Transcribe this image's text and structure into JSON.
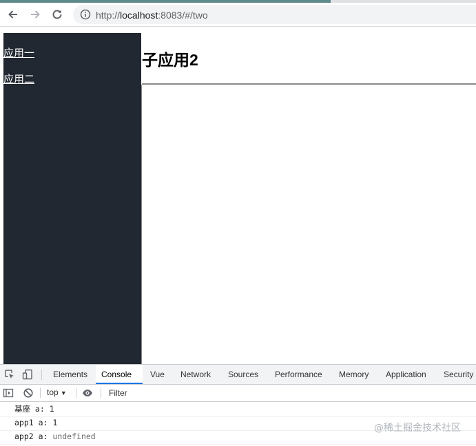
{
  "browser": {
    "url_prefix": "http://",
    "url_host": "localhost",
    "url_rest": ":8083/#/two",
    "back_icon": "arrow-left-icon",
    "forward_icon": "arrow-right-icon",
    "reload_icon": "reload-icon",
    "info_icon": "info-icon"
  },
  "sidebar": {
    "items": [
      {
        "label": "应用一"
      },
      {
        "label": "应用二"
      }
    ]
  },
  "main": {
    "title": "子应用2"
  },
  "devtools": {
    "tabs": [
      {
        "label": "Elements"
      },
      {
        "label": "Console",
        "active": true
      },
      {
        "label": "Vue"
      },
      {
        "label": "Network"
      },
      {
        "label": "Sources"
      },
      {
        "label": "Performance"
      },
      {
        "label": "Memory"
      },
      {
        "label": "Application"
      },
      {
        "label": "Security"
      }
    ],
    "context": "top",
    "filter_placeholder": "Filter",
    "console": [
      {
        "label": "基座 a:",
        "value": "1"
      },
      {
        "label": "app1 a:",
        "value": "1"
      },
      {
        "label": "app2 a:",
        "value": "undefined"
      }
    ]
  },
  "watermark": "@稀土掘金技术社区",
  "colors": {
    "sidebar_bg": "#222831",
    "active_tab_underline": "#1a73e8"
  }
}
